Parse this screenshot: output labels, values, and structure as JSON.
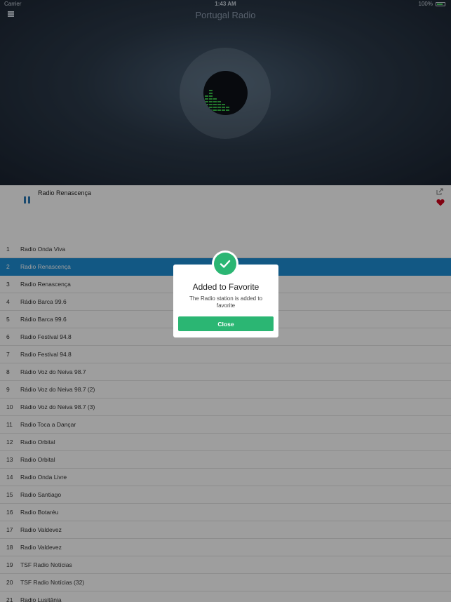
{
  "status_bar": {
    "carrier": "Carrier",
    "time": "1:43 AM",
    "battery": "100%",
    "battery_color": "#4cd964"
  },
  "header": {
    "title": "Portugal Radio",
    "menu_icon": "hamburger-icon"
  },
  "now_playing": {
    "station": "Radio Renascença",
    "state": "playing",
    "controls": {
      "pause_icon": "pause-icon",
      "share_icon": "share-icon",
      "favorite_icon": "heart-icon"
    }
  },
  "stations": [
    {
      "num": "1",
      "name": "Radio Onda Viva"
    },
    {
      "num": "2",
      "name": "Radio Renascença",
      "active": true
    },
    {
      "num": "3",
      "name": "Radio Renascença"
    },
    {
      "num": "4",
      "name": "Rádio Barca 99.6"
    },
    {
      "num": "5",
      "name": "Rádio Barca 99.6"
    },
    {
      "num": "6",
      "name": "Radio Festival 94.8"
    },
    {
      "num": "7",
      "name": "Radio Festival 94.8"
    },
    {
      "num": "8",
      "name": "Rádio Voz do Neiva 98.7"
    },
    {
      "num": "9",
      "name": "Rádio Voz do Neiva 98.7 (2)"
    },
    {
      "num": "10",
      "name": "Rádio Voz do Neiva 98.7 (3)"
    },
    {
      "num": "11",
      "name": "Radio Toca a Dançar"
    },
    {
      "num": "12",
      "name": "Radio Orbital"
    },
    {
      "num": "13",
      "name": "Radio Orbital"
    },
    {
      "num": "14",
      "name": "Radio Onda Livre"
    },
    {
      "num": "15",
      "name": "Radio Santiago"
    },
    {
      "num": "16",
      "name": "Radio Botaréu"
    },
    {
      "num": "17",
      "name": "Radio Valdevez"
    },
    {
      "num": "18",
      "name": "Radio Valdevez"
    },
    {
      "num": "19",
      "name": "TSF Radio Notícias"
    },
    {
      "num": "20",
      "name": "TSF Radio Notícias (32)"
    },
    {
      "num": "21",
      "name": "Radio Lusitânia"
    }
  ],
  "modal": {
    "title": "Added to Favorite",
    "message": "The Radio station is added to favorite",
    "close_label": "Close",
    "icon": "checkmark-icon",
    "accent_color": "#2bb673"
  },
  "colors": {
    "active_row": "#1e8fd6",
    "pause_icon": "#2a78b4",
    "heart": "#d0021b"
  }
}
